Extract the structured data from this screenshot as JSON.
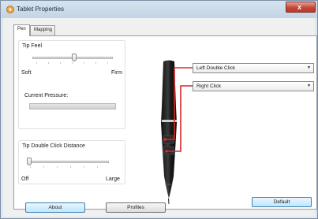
{
  "window": {
    "title": "Tablet Properties",
    "close_glyph": "x"
  },
  "tabs": [
    {
      "label": "Pen",
      "active": true
    },
    {
      "label": "Mapping",
      "active": false
    }
  ],
  "tip_feel": {
    "heading": "Tip Feel",
    "min_label": "Soft",
    "max_label": "Firm",
    "current_pressure_label": "Current Pressure:"
  },
  "double_click": {
    "heading": "Tip Double Click Distance",
    "min_label": "Off",
    "max_label": "Large"
  },
  "buttons": {
    "upper_selection": "Left Double Click",
    "lower_selection": "Right Click"
  },
  "footer": {
    "default_label": "Default",
    "about_label": "About",
    "profiles_label": "Profiles"
  },
  "icons": {
    "app": "tablet-app-icon",
    "dropdown": "chevron-down-icon"
  },
  "colors": {
    "callout_lines": "#d7282a",
    "active_button_blue": "#bee6fd"
  }
}
